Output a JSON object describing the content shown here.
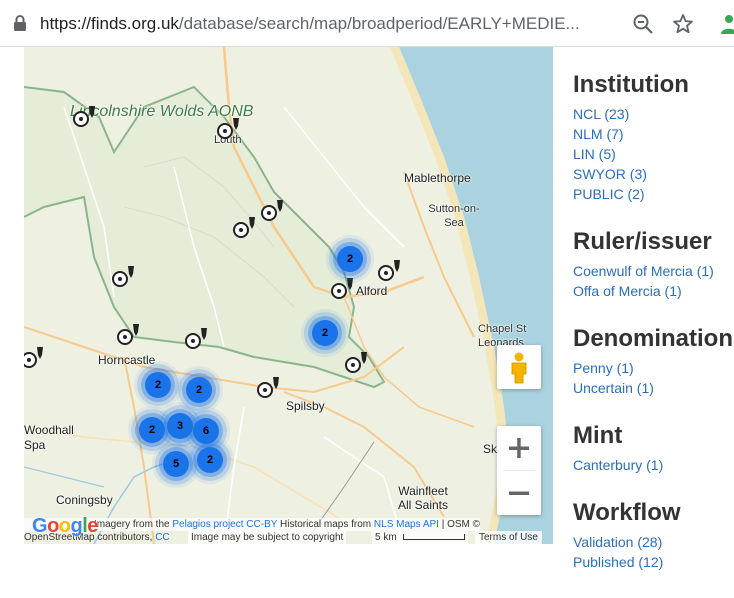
{
  "browser": {
    "url_host": "https://finds.org.uk",
    "url_path": "/database/search/map/broadperiod/EARLY+MEDIE..."
  },
  "map": {
    "labels": {
      "aonb": "Lincolnshire Wolds AONB",
      "louth": "Louth",
      "mablethorpe": "Mablethorpe",
      "sutton": "Sutton-on-Sea",
      "alford": "Alford",
      "chapel": "Chapel St Leonards",
      "horncastle": "Horncastle",
      "spilsby": "Spilsby",
      "woodhall": "Woodhall Spa",
      "wainfleet": "Wainfleet All Saints",
      "coningsby": "Coningsby",
      "skegness": "Ske"
    },
    "clusters": [
      "2",
      "2",
      "2",
      "2",
      "3",
      "6",
      "2",
      "5",
      "2"
    ],
    "attribution": {
      "line1_pre": "Imagery from the ",
      "pelagios": "Pelagios project",
      "ccby": "CC-BY",
      "historical": " Historical maps from ",
      "nls": "NLS Maps API",
      "osm": " | OSM ©",
      "line2_pre": "OpenStreetMap contributors, ",
      "cc": "CC",
      "copyright": "Image may be subject to copyright",
      "scale": "5 km",
      "terms": "Terms of Use"
    },
    "google_letters": [
      "G",
      "o",
      "o",
      "g",
      "l",
      "e"
    ]
  },
  "facets": [
    {
      "title": "Institution",
      "items": [
        "NCL (23)",
        "NLM (7)",
        "LIN (5)",
        "SWYOR (3)",
        "PUBLIC (2)"
      ]
    },
    {
      "title": "Ruler/issuer",
      "items": [
        "Coenwulf of Mercia (1)",
        "Offa of Mercia (1)"
      ]
    },
    {
      "title": "Denomination",
      "items": [
        "Penny (1)",
        "Uncertain (1)"
      ]
    },
    {
      "title": "Mint",
      "items": [
        "Canterbury (1)"
      ]
    },
    {
      "title": "Workflow",
      "items": [
        "Validation (28)",
        "Published (12)"
      ]
    }
  ]
}
